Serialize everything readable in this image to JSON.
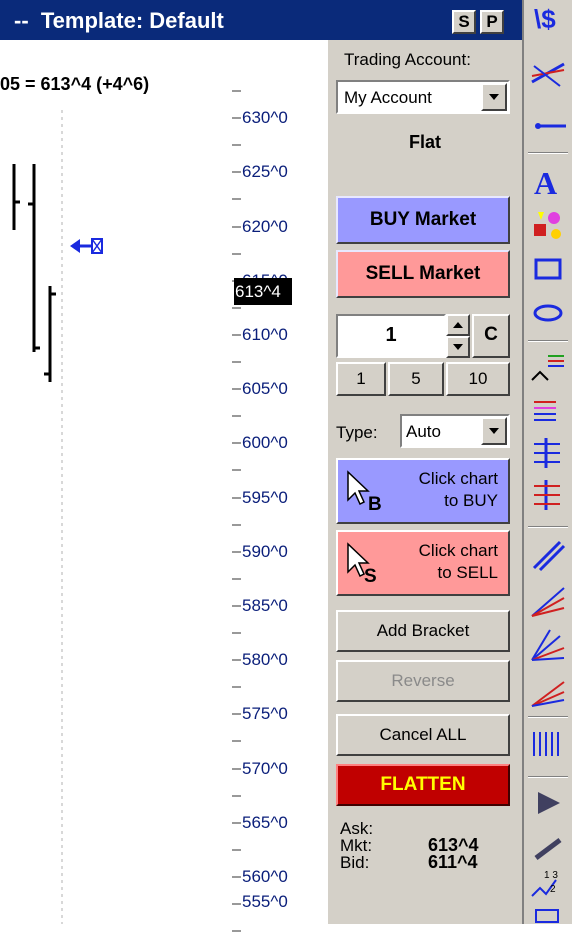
{
  "titlebar": {
    "title": "--  Template: Default",
    "btn_s": "S",
    "btn_p": "P"
  },
  "chart": {
    "quote": "05 = 613^4 (+4^6)",
    "price_marker": "613^4",
    "axis_labels": [
      "630^0",
      "625^0",
      "620^0",
      "615^0",
      "610^0",
      "605^0",
      "600^0",
      "595^0",
      "590^0",
      "585^0",
      "580^0",
      "575^0",
      "570^0",
      "565^0",
      "560^0",
      "555^0"
    ]
  },
  "panel": {
    "trading_account_label": "Trading Account:",
    "account_value": "My Account",
    "position_status": "Flat",
    "buy_market": "BUY Market",
    "sell_market": "SELL Market",
    "quantity": "1",
    "clear_label": "C",
    "qty_presets": [
      "1",
      "5",
      "10"
    ],
    "type_label": "Type:",
    "type_value": "Auto",
    "click_buy_line1": "Click chart",
    "click_buy_line2": "to BUY",
    "click_sell_line1": "Click chart",
    "click_sell_line2": "to SELL",
    "cursor_b": "B",
    "cursor_s": "S",
    "add_bracket": "Add Bracket",
    "reverse": "Reverse",
    "cancel_all": "Cancel ALL",
    "flatten": "FLATTEN",
    "ask_label": "Ask:",
    "mkt_label": "Mkt:",
    "bid_label": "Bid:",
    "mkt_value": "613^4",
    "bid_value": "611^4"
  },
  "colors": {
    "title_bg": "#0a2a7a",
    "buy": "#9999ff",
    "sell": "#ff9999",
    "flatten_bg": "#c00000",
    "flatten_text": "#ffff00",
    "axis_text": "#0a1e7a"
  }
}
